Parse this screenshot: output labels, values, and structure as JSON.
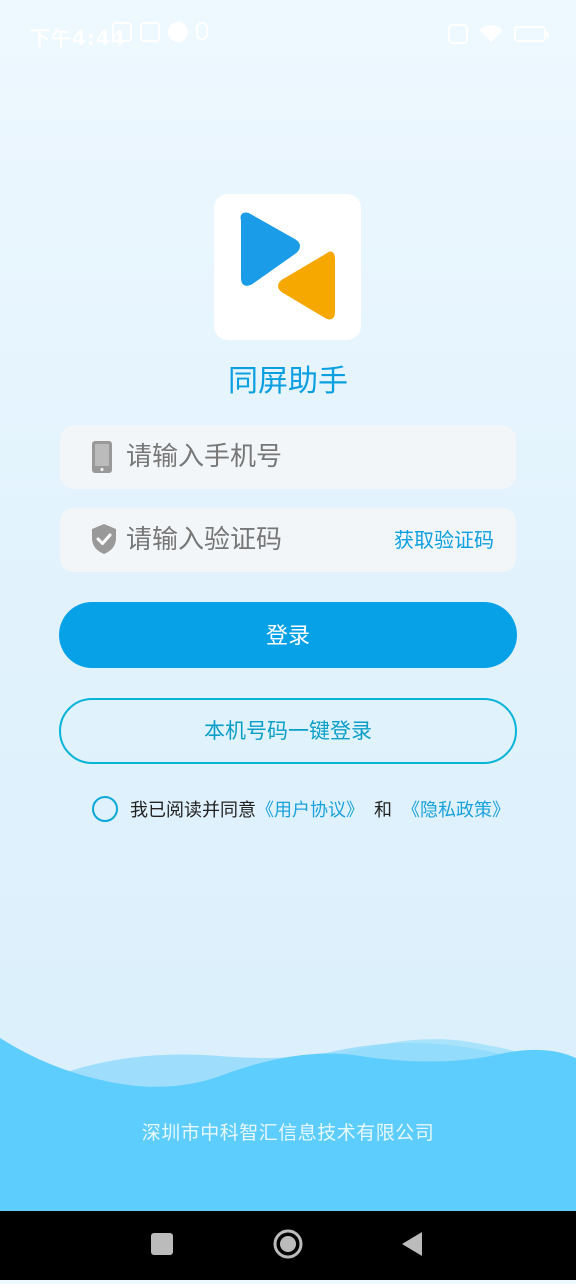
{
  "status_bar": {
    "time": "下午4:44",
    "icons": [
      "no-sound-icon",
      "app-notification-icon",
      "check-notification-icon",
      "info-icon"
    ],
    "right_icons": [
      "sim-icon",
      "wifi-icon",
      "battery-icon"
    ]
  },
  "app": {
    "name": "同屏助手",
    "logo_colors": {
      "blue": "#1a9ce8",
      "orange": "#f7a800"
    }
  },
  "form": {
    "phone_placeholder": "请输入手机号",
    "code_placeholder": "请输入验证码",
    "get_code_label": "获取验证码"
  },
  "buttons": {
    "login": "登录",
    "one_key_login": "本机号码一键登录"
  },
  "agreement": {
    "prefix": "我已阅读并同意",
    "user_agreement": "《用户协议》",
    "and": "和",
    "privacy_policy": "《隐私政策》"
  },
  "footer": {
    "company": "深圳市中科智汇信息技术有限公司"
  },
  "colors": {
    "accent": "#07a1e7",
    "wave": "#5ccdfc"
  }
}
